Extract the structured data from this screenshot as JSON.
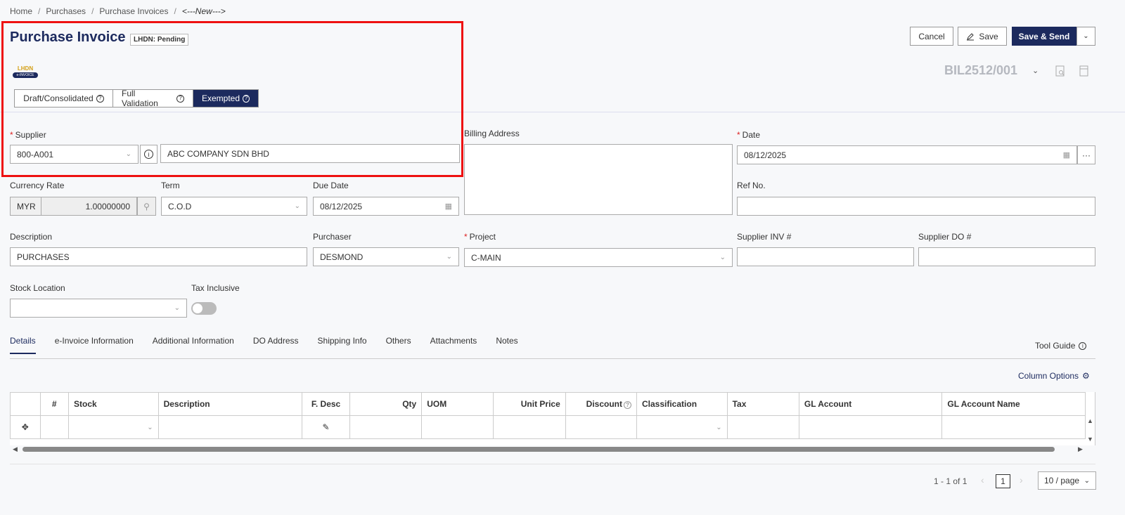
{
  "breadcrumb": {
    "home": "Home",
    "purchases": "Purchases",
    "invoices": "Purchase Invoices",
    "current": "<---New--->"
  },
  "page": {
    "title": "Purchase Invoice",
    "lhdn_status": "LHDN: Pending",
    "doc_no": "BIL2512/001"
  },
  "logo": {
    "text": "LHDN",
    "sub": "e-INVOICE"
  },
  "validation_modes": [
    "Draft/Consolidated",
    "Full Validation",
    "Exempted"
  ],
  "validation_active": "Exempted",
  "actions": {
    "cancel": "Cancel",
    "save": "Save",
    "save_send": "Save & Send"
  },
  "form": {
    "supplier_label": "Supplier",
    "supplier_code": "800-A001",
    "supplier_name": "ABC COMPANY SDN BHD",
    "billing_label": "Billing Address",
    "date_label": "Date",
    "date_value": "08/12/2025",
    "currency_label": "Currency Rate",
    "currency": "MYR",
    "rate": "1.00000000",
    "term_label": "Term",
    "term_value": "C.O.D",
    "due_label": "Due Date",
    "due_value": "08/12/2025",
    "ref_label": "Ref No.",
    "desc_label": "Description",
    "desc_value": "PURCHASES",
    "purchaser_label": "Purchaser",
    "purchaser_value": "DESMOND",
    "project_label": "Project",
    "project_value": "C-MAIN",
    "supp_inv_label": "Supplier INV #",
    "supp_do_label": "Supplier DO #",
    "stock_loc_label": "Stock Location",
    "tax_incl_label": "Tax Inclusive"
  },
  "tabs": [
    "Details",
    "e-Invoice Information",
    "Additional Information",
    "DO Address",
    "Shipping Info",
    "Others",
    "Attachments",
    "Notes"
  ],
  "tool_guide": "Tool Guide",
  "column_options": "Column Options",
  "table_headers": [
    "#",
    "Stock",
    "Description",
    "F. Desc",
    "Qty",
    "UOM",
    "Unit Price",
    "Discount",
    "Classification",
    "Tax",
    "GL Account",
    "GL Account Name"
  ],
  "pagination": {
    "range": "1 - 1 of 1",
    "page": "1",
    "per_page": "10 / page"
  },
  "colors": {
    "primary": "#1c2a5e",
    "highlight": "#e11111"
  }
}
